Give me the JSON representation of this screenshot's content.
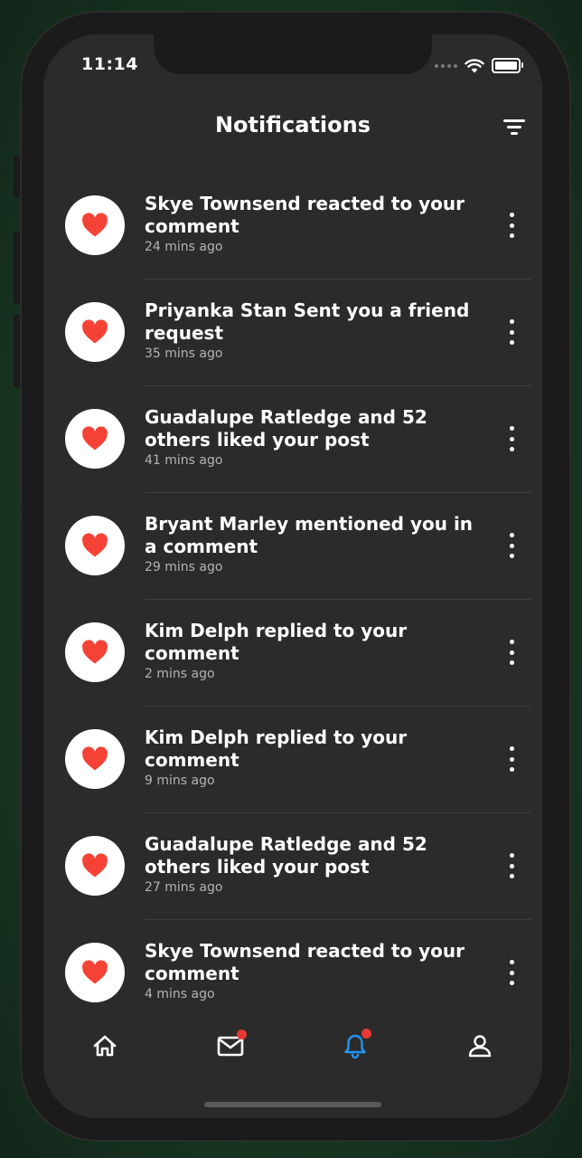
{
  "status_bar": {
    "time": "11:14"
  },
  "header": {
    "title": "Notifications"
  },
  "notifications": [
    {
      "title": "Skye Townsend reacted to your comment",
      "time": "24 mins ago"
    },
    {
      "title": "Priyanka Stan Sent you a friend request",
      "time": "35 mins ago"
    },
    {
      "title": "Guadalupe Ratledge and 52 others liked your post",
      "time": "41 mins ago"
    },
    {
      "title": "Bryant Marley mentioned you in a comment",
      "time": "29 mins ago"
    },
    {
      "title": "Kim Delph replied to your comment",
      "time": "2 mins ago"
    },
    {
      "title": "Kim Delph replied to your comment",
      "time": "9 mins ago"
    },
    {
      "title": "Guadalupe Ratledge and 52 others liked your post",
      "time": "27 mins ago"
    },
    {
      "title": "Skye Townsend reacted to your comment",
      "time": "4 mins ago"
    }
  ],
  "tabbar": {
    "items": [
      {
        "icon": "home-icon",
        "active": false,
        "badge": false
      },
      {
        "icon": "mail-icon",
        "active": false,
        "badge": true
      },
      {
        "icon": "bell-icon",
        "active": true,
        "badge": true
      },
      {
        "icon": "profile-icon",
        "active": false,
        "badge": false
      }
    ]
  },
  "colors": {
    "background": "#2b2b2b",
    "heart": "#f44336",
    "active_tab": "#2196f3",
    "badge": "#e53935",
    "secondary_text": "#b4b4b4"
  }
}
